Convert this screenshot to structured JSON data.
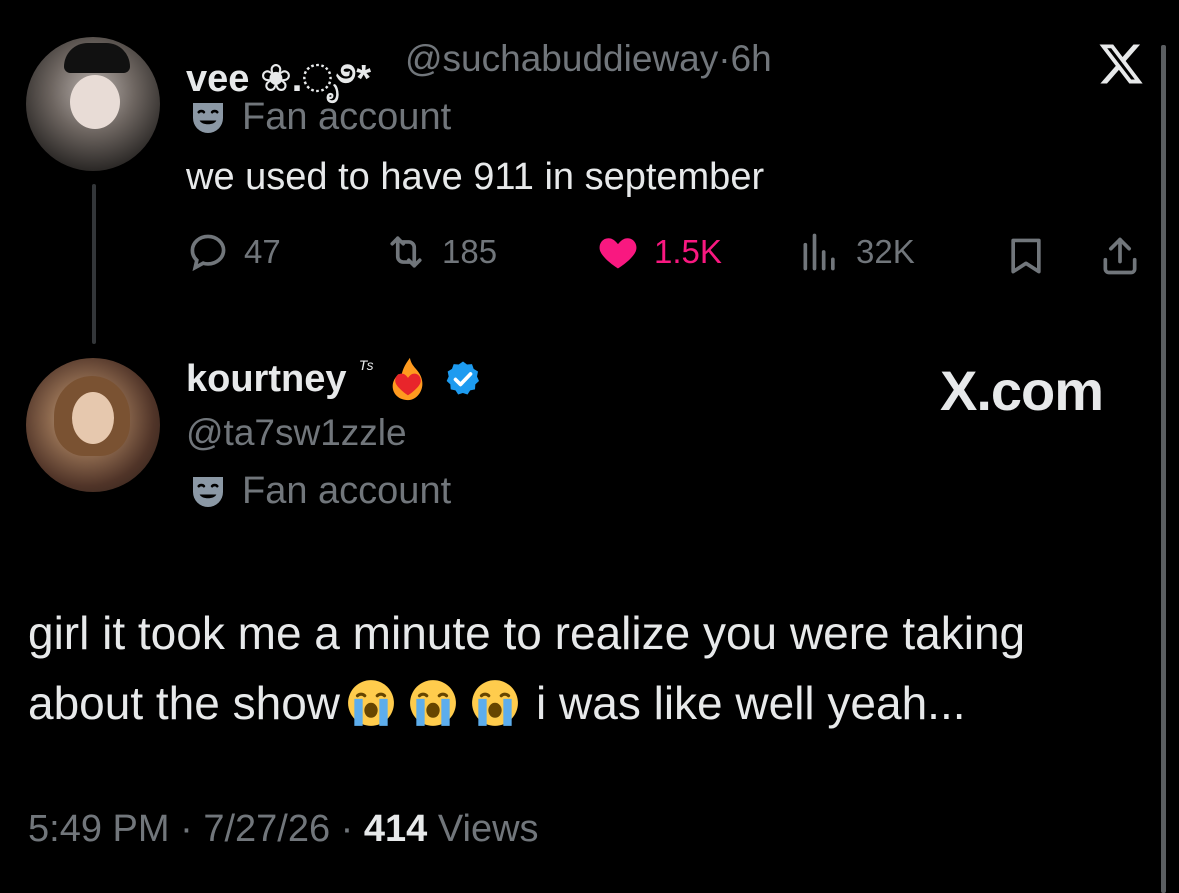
{
  "watermark": {
    "logo_text": "X.com"
  },
  "parent_tweet": {
    "display_name": "vee ❀.ೃ࿔*",
    "handle": "@suchabuddieway",
    "separator": "·",
    "time_ago": "6h",
    "label": "Fan account",
    "text": "we used to have 911 in september",
    "actions": {
      "replies": "47",
      "reposts": "185",
      "likes": "1.5K",
      "views": "32K"
    }
  },
  "reply_tweet": {
    "display_name": "kourtney",
    "name_suffix": "ᵀˢ",
    "handle": "@ta7sw1zzle",
    "label": "Fan account",
    "text_line1": "girl it took me a minute to realize you were taking",
    "text_line2_start": "about the show",
    "text_line2_end": "i was like well yeah...",
    "emoji_icon": "loudly-crying-face-icon",
    "timestamp": "5:49 PM",
    "date": "7/27/26",
    "views_count": "414",
    "views_label": "Views"
  },
  "colors": {
    "background": "#000000",
    "primary_text": "#e7e9ea",
    "secondary_text": "#71767b",
    "like": "#f91880",
    "verified": "#1d9bf0"
  }
}
